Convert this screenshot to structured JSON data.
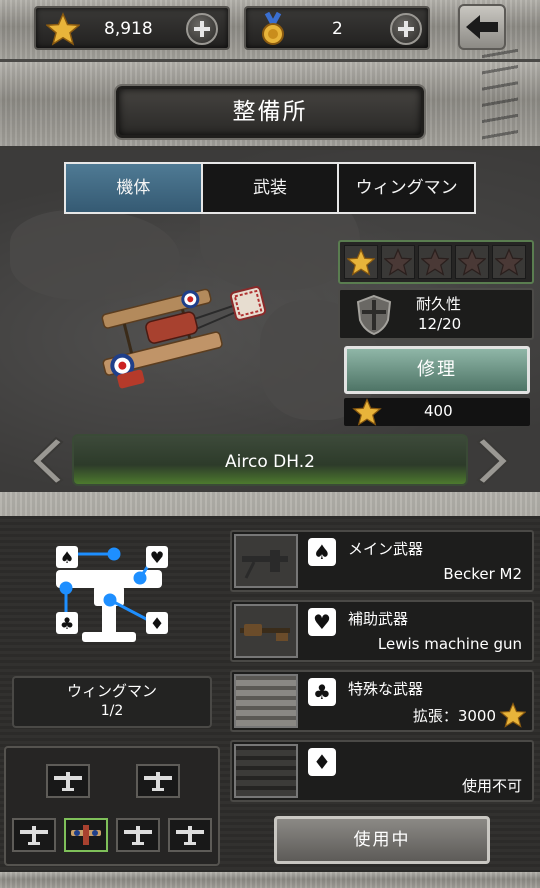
{
  "header": {
    "stars_count": "8,918",
    "medals_count": "2",
    "title": "整備所"
  },
  "tabs": [
    {
      "label": "機体",
      "active": true
    },
    {
      "label": "武装",
      "active": false
    },
    {
      "label": "ウィングマン",
      "active": false
    }
  ],
  "aircraft": {
    "name": "Airco DH.2",
    "rank_stars": 1,
    "rank_stars_max": 5,
    "durability_label": "耐久性",
    "durability_value": "12/20",
    "repair_label": "修理",
    "repair_cost": "400"
  },
  "wingman": {
    "label": "ウィングマン",
    "count": "1/2"
  },
  "weapons": [
    {
      "suit": "♠",
      "title": "メイン武器",
      "name": "Becker M2"
    },
    {
      "suit": "♥",
      "title": "補助武器",
      "name": "Lewis machine gun"
    },
    {
      "suit": "♣",
      "title": "特殊な武器",
      "name": "拡張：3000"
    },
    {
      "suit": "♦",
      "title": "",
      "name": "使用不可"
    }
  ],
  "footer": {
    "in_use_label": "使用中"
  },
  "colors": {
    "tab_active": "#4f7a94",
    "repair_button": "#6f9889",
    "name_bar_glow": "#4d7a2e",
    "star_gold": "#e8b43a",
    "slot_link_blue": "#1e8fff"
  }
}
